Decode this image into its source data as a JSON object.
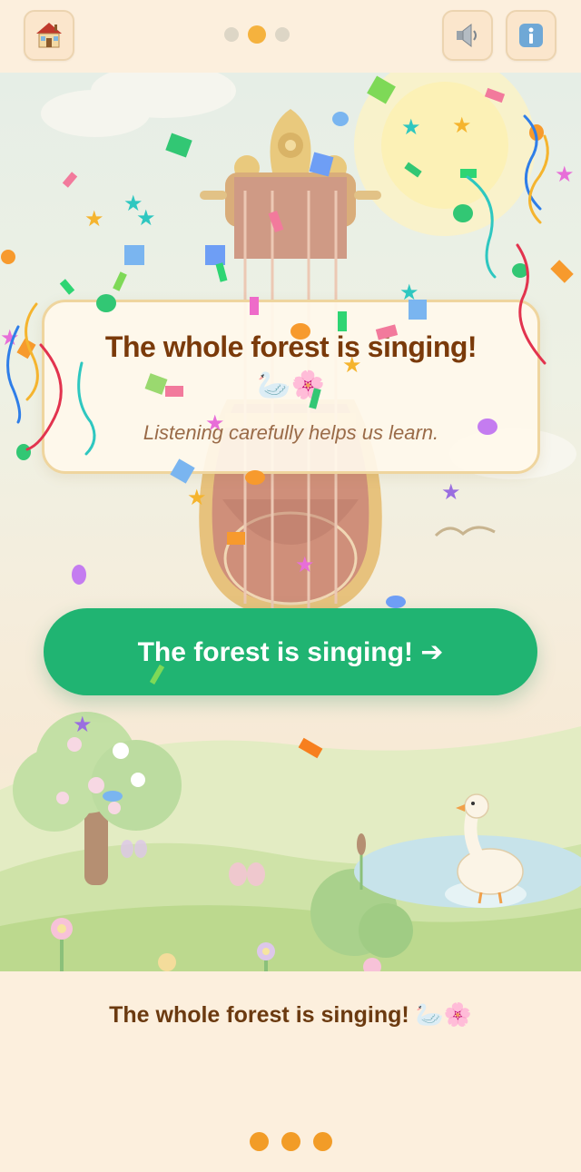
{
  "topbar": {
    "home_icon": "house-icon",
    "sound_icon": "speaker-icon",
    "info_icon": "info-icon",
    "progress_step": 2,
    "progress_total": 3
  },
  "card": {
    "title": "The whole forest is singing!",
    "emojis": "🦢🌸",
    "subtitle": "Listening carefully helps us learn."
  },
  "cta": {
    "label": "The forest is singing! ➔"
  },
  "footer": {
    "caption": "The whole forest is singing! 🦢🌸",
    "dots_count": 3
  },
  "colors": {
    "cta": "#20b472",
    "title": "#7a3a0a",
    "dots": "#f29c27"
  }
}
